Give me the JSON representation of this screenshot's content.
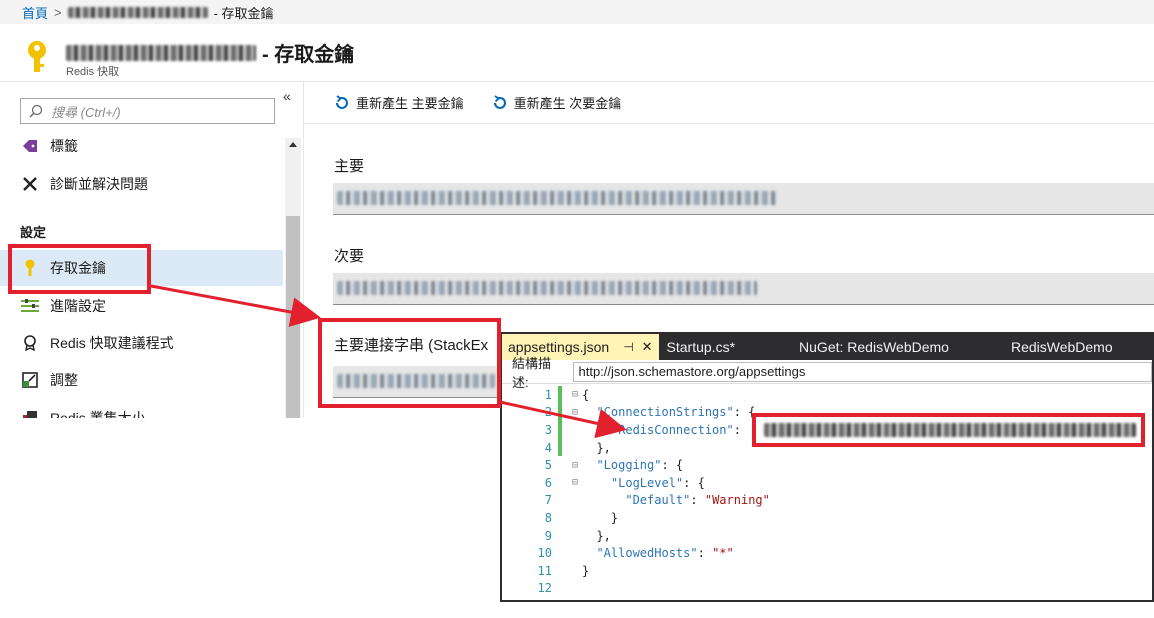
{
  "breadcrumb": {
    "home": "首頁",
    "separator": ">",
    "suffix": "- 存取金鑰"
  },
  "header": {
    "title_suffix": "- 存取金鑰",
    "subtitle": "Redis 快取"
  },
  "sidebar": {
    "search_placeholder": "搜尋 (Ctrl+/)",
    "collapse": "«",
    "section_label": "設定",
    "items": [
      {
        "label": "標籤",
        "icon": "tag-icon"
      },
      {
        "label": "診斷並解決問題",
        "icon": "wrench-icon"
      },
      {
        "label": "存取金鑰",
        "icon": "key-icon"
      },
      {
        "label": "進階設定",
        "icon": "settings-lines-icon"
      },
      {
        "label": "Redis 快取建議程式",
        "icon": "advisor-icon"
      },
      {
        "label": "調整",
        "icon": "scale-icon"
      },
      {
        "label": "Redis 叢集大小",
        "icon": "cluster-icon"
      }
    ]
  },
  "toolbar": {
    "regen_primary": "重新產生 主要金鑰",
    "regen_secondary": "重新產生 次要金鑰"
  },
  "fields": {
    "primary": "主要",
    "secondary": "次要",
    "conn_string": "主要連接字串 (StackEx"
  },
  "editor": {
    "tabs": [
      "appsettings.json",
      "Startup.cs*",
      "NuGet: RedisWebDemo",
      "RedisWebDemo"
    ],
    "pin": "⊣",
    "close": "✕",
    "schema_label": "結構描述:",
    "schema_url": "http://json.schemastore.org/appsettings",
    "lines": [
      {
        "n": "1",
        "text": "{"
      },
      {
        "n": "2",
        "key": "\"ConnectionStrings\"",
        "rest": ": {"
      },
      {
        "n": "3",
        "key": "\"RedisConnection\"",
        "rest": ": "
      },
      {
        "n": "4",
        "text": "},"
      },
      {
        "n": "5",
        "key": "\"Logging\"",
        "rest": ": {"
      },
      {
        "n": "6",
        "key": "\"LogLevel\"",
        "rest": ": {"
      },
      {
        "n": "7",
        "key": "\"Default\"",
        "rest": ": ",
        "str": "\"Warning\""
      },
      {
        "n": "8",
        "text": "}"
      },
      {
        "n": "9",
        "text": "},"
      },
      {
        "n": "10",
        "key": "\"AllowedHosts\"",
        "rest": ": ",
        "str": "\"*\""
      },
      {
        "n": "11",
        "text": "}"
      },
      {
        "n": "12",
        "text": ""
      }
    ]
  },
  "colors": {
    "accent": "#0066b8",
    "callout": "#e3202d",
    "active_nav": "#dceaf7",
    "tab_bar": "#2d2d30",
    "active_tab": "#fff3b5"
  }
}
